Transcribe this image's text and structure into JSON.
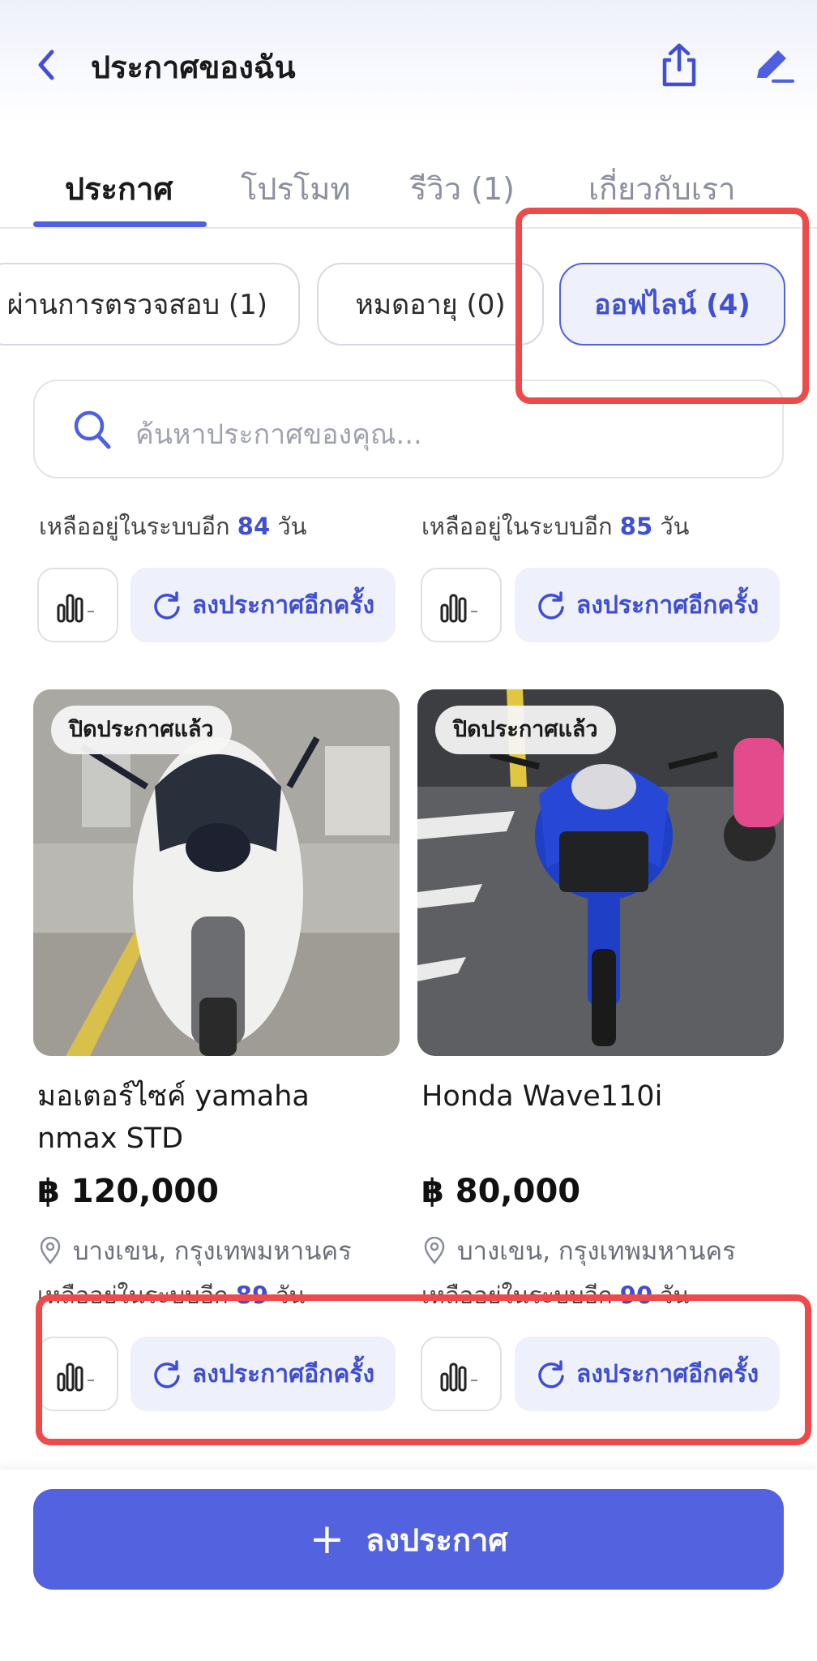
{
  "header": {
    "title": "ประกาศของฉัน"
  },
  "tabs": [
    {
      "label": "ประกาศ",
      "active": true
    },
    {
      "label": "โปรโมท",
      "active": false
    },
    {
      "label": "รีวิว (1)",
      "active": false
    },
    {
      "label": "เกี่ยวกับเรา",
      "active": false
    }
  ],
  "filters": [
    {
      "label": "ผ่านการตรวจสอบ (1)",
      "active": false
    },
    {
      "label": "หมดอายุ (0)",
      "active": false
    },
    {
      "label": "ออฟไลน์ (4)",
      "active": true
    }
  ],
  "search": {
    "placeholder": "ค้นหาประกาศของคุณ..."
  },
  "labels": {
    "remaining_prefix": "เหลืออยู่ในระบบอีก",
    "remaining_suffix": "วัน",
    "relist": "ลงประกาศอีกครั้ง",
    "closed_badge": "ปิดประกาศแล้ว",
    "stat_dash": "-"
  },
  "top_listings": [
    {
      "days_remaining": "84"
    },
    {
      "days_remaining": "85"
    }
  ],
  "listings": [
    {
      "title": "มอเตอร์ไซค์ yamaha nmax STD",
      "price": "฿ 120,000",
      "location": "บางเขน, กรุงเทพมหานคร",
      "days_remaining": "89",
      "status": "ปิดประกาศแล้ว"
    },
    {
      "title": "Honda Wave110i",
      "price": "฿ 80,000",
      "location": "บางเขน, กรุงเทพมหานคร",
      "days_remaining": "90",
      "status": "ปิดประกาศแล้ว"
    }
  ],
  "bottom_bar": {
    "post_label": "ลงประกาศ"
  },
  "colors": {
    "accent": "#5160e0",
    "highlight": "#ee4a4a",
    "chip_active_bg": "#eef0fc"
  }
}
